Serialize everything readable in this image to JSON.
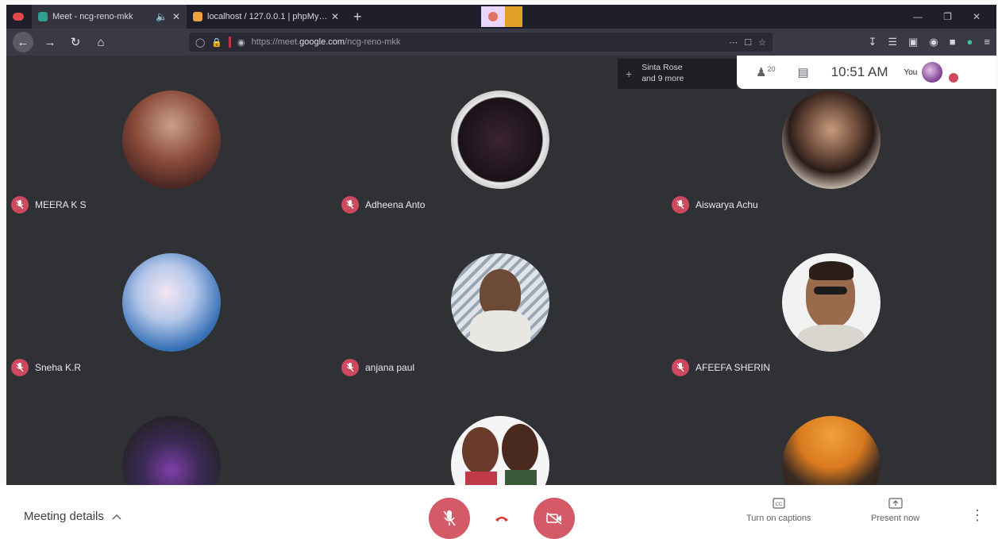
{
  "browser": {
    "tabs": [
      {
        "title": "Meet - ncg-reno-mkk",
        "active": true
      },
      {
        "title": "localhost / 127.0.0.1 | phpMy…",
        "active": false
      }
    ],
    "url": {
      "prefix": "https://meet.",
      "domain": "google.com",
      "path": "/ncg-reno-mkk"
    }
  },
  "meet": {
    "participants_pill": {
      "line1": "Sinta Rose",
      "line2": "and 9 more"
    },
    "participant_count": "20",
    "clock": "10:51 AM",
    "self_label": "You",
    "participants": [
      {
        "name": "MEERA K S"
      },
      {
        "name": "Adheena Anto"
      },
      {
        "name": "Aiswarya Achu"
      },
      {
        "name": "Sneha K.R"
      },
      {
        "name": "anjana paul"
      },
      {
        "name": "AFEEFA SHERIN"
      }
    ]
  },
  "bottombar": {
    "meeting_details": "Meeting details",
    "captions": "Turn on captions",
    "present": "Present now"
  },
  "colors": {
    "meet_bg": "#303134",
    "mic_off_red": "#d0485e",
    "control_red": "#d45a68"
  }
}
